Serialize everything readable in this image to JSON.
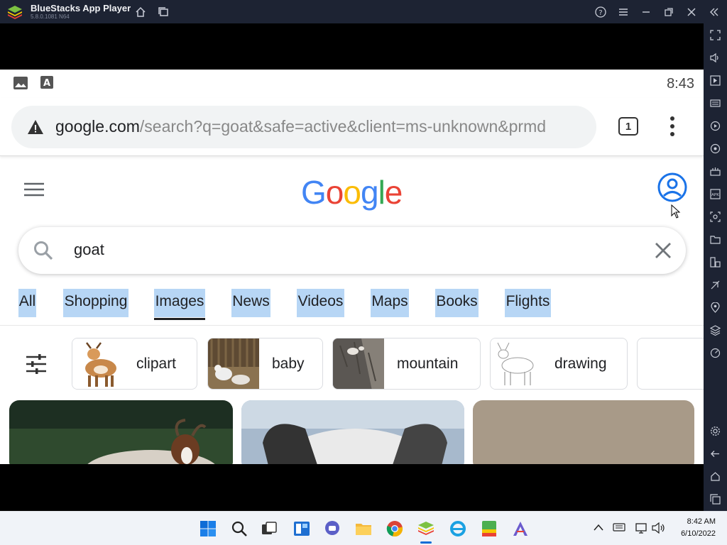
{
  "window": {
    "app_title": "BlueStacks App Player",
    "version": "5.8.0.1081 N64"
  },
  "android": {
    "clock": "8:43"
  },
  "browser": {
    "url_host": "google.com",
    "url_path": "/search?q=goat&safe=active&client=ms-unknown&prmd",
    "tab_count": "1"
  },
  "google": {
    "logo_letters": [
      "G",
      "o",
      "o",
      "g",
      "l",
      "e"
    ],
    "logo_colors": [
      "#4285F4",
      "#EA4335",
      "#FBBC05",
      "#4285F4",
      "#34A853",
      "#EA4335"
    ],
    "query": "goat"
  },
  "tabs": [
    {
      "label": "All"
    },
    {
      "label": "Shopping"
    },
    {
      "label": "Images"
    },
    {
      "label": "News"
    },
    {
      "label": "Videos"
    },
    {
      "label": "Maps"
    },
    {
      "label": "Books"
    },
    {
      "label": "Flights"
    }
  ],
  "chips": [
    {
      "label": "clipart"
    },
    {
      "label": "baby"
    },
    {
      "label": "mountain"
    },
    {
      "label": "drawing"
    }
  ],
  "taskbar": {
    "time": "8:42 AM",
    "date": "6/10/2022"
  },
  "colors": {
    "titlebar_bg": "#1d2333",
    "tab_highlight": "#b7d6f5",
    "accent_blue": "#1a73e8"
  }
}
